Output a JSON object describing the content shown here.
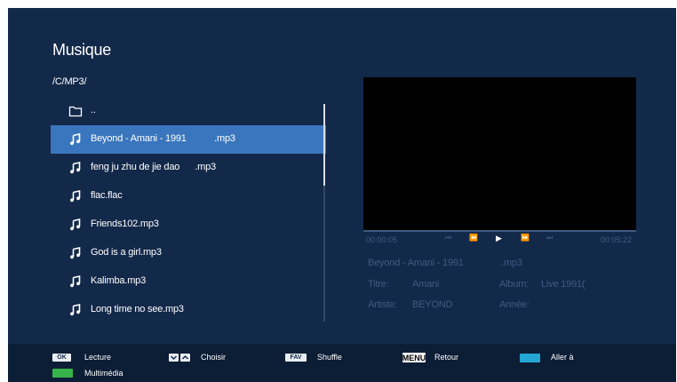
{
  "title": "Musique",
  "path": "/C/MP3/",
  "files": [
    {
      "icon": "folder-icon",
      "label": ".."
    },
    {
      "icon": "music-note-icon",
      "label": "Beyond - Amani - 1991           .mp3",
      "selected": true
    },
    {
      "icon": "music-note-icon",
      "label": "feng ju zhu de jie dao      .mp3"
    },
    {
      "icon": "music-note-icon",
      "label": "flac.flac"
    },
    {
      "icon": "music-note-icon",
      "label": "Friends102.mp3"
    },
    {
      "icon": "music-note-icon",
      "label": "God is a girl.mp3"
    },
    {
      "icon": "music-note-icon",
      "label": "Kalimba.mp3"
    },
    {
      "icon": "music-note-icon",
      "label": "Long time no see.mp3"
    }
  ],
  "player": {
    "time_start": "00:00:05",
    "time_end": "00:05:22",
    "controls": {
      "prev_track": "⏮",
      "rewind": "⏪",
      "play": "▶",
      "fast_forward": "⏩",
      "next_track": "⏭"
    }
  },
  "info": {
    "now_playing": "Beyond - Amani - 1991",
    "now_playing_ext": ".mp3",
    "title_label": "Titre:",
    "title_value": "Amani",
    "album_label": "Album:",
    "album_value": "Live 1991(",
    "artist_label": "Artiste:",
    "artist_value": "BEYOND",
    "year_label": "Année:",
    "year_value": ""
  },
  "bottom_bar": {
    "ok_key": "OK",
    "ok_label": "Lecture",
    "choose_label": "Choisir",
    "fav_key": "FAV",
    "fav_label": "Shuffle",
    "menu_key": "MENU",
    "menu_label": "Retour",
    "blue_label": "Aller à",
    "green_label": "Multimédia"
  },
  "colors": {
    "background": "#13294a",
    "selection": "#3a76bd",
    "dim_text": "#3f5b82",
    "blue_key": "#25a7d4",
    "green_key": "#37b44a"
  }
}
